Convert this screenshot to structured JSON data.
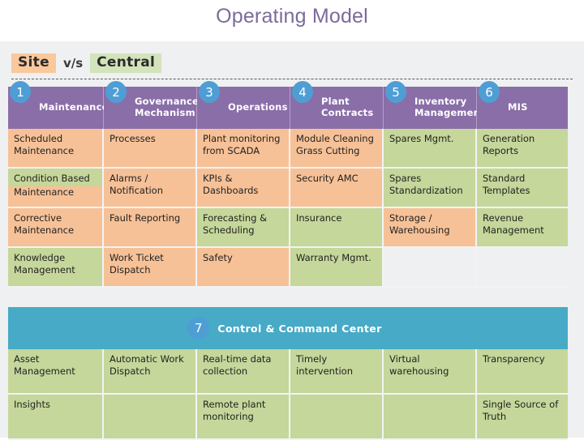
{
  "slide": {
    "title": "Operating Model",
    "title_color": "#7b6b9a",
    "background": "#eff0f1"
  },
  "legend": {
    "site_label": "Site",
    "vs_label": "v/s",
    "central_label": "Central",
    "site_color": "#f9c89b",
    "central_color": "#d3e3bb"
  },
  "colors": {
    "header_purple": "#8a6ea8",
    "badge_blue": "#4e9ed4",
    "ccc_teal": "#47aac6",
    "site_cell": "#f7c197",
    "central_cell": "#c5d79a",
    "empty_cell": "#eff0f1"
  },
  "main_matrix": {
    "columns": [
      {
        "number": "1",
        "label": "Maintenance"
      },
      {
        "number": "2",
        "label": "Governance Mechanism"
      },
      {
        "number": "3",
        "label": "Operations"
      },
      {
        "number": "4",
        "label": "Plant Contracts"
      },
      {
        "number": "5",
        "label": "Inventory Management"
      },
      {
        "number": "6",
        "label": "MIS"
      }
    ],
    "rows": [
      [
        {
          "text": "Scheduled Maintenance",
          "owner": "site"
        },
        {
          "text": "Processes",
          "owner": "site"
        },
        {
          "text": "Plant monitoring from SCADA",
          "owner": "site"
        },
        {
          "text": "Module Cleaning Grass Cutting",
          "owner": "site"
        },
        {
          "text": "Spares Mgmt.",
          "owner": "central"
        },
        {
          "text": "Generation Reports",
          "owner": "central"
        }
      ],
      [
        {
          "text": "Condition Based Maintenance",
          "owner": "mixed",
          "line1": "Condition Based",
          "line2": "Maintenance"
        },
        {
          "text": "Alarms / Notification",
          "owner": "site"
        },
        {
          "text": "KPIs & Dashboards",
          "owner": "site"
        },
        {
          "text": "Security AMC",
          "owner": "site"
        },
        {
          "text": "Spares Standardization",
          "owner": "central"
        },
        {
          "text": "Standard Templates",
          "owner": "central"
        }
      ],
      [
        {
          "text": "Corrective Maintenance",
          "owner": "site"
        },
        {
          "text": "Fault Reporting",
          "owner": "site"
        },
        {
          "text": "Forecasting & Scheduling",
          "owner": "central"
        },
        {
          "text": "Insurance",
          "owner": "central"
        },
        {
          "text": "Storage / Warehousing",
          "owner": "site"
        },
        {
          "text": "Revenue Management",
          "owner": "central"
        }
      ],
      [
        {
          "text": "Knowledge Management",
          "owner": "central"
        },
        {
          "text": "Work Ticket Dispatch",
          "owner": "site"
        },
        {
          "text": "Safety",
          "owner": "site"
        },
        {
          "text": "Warranty Mgmt.",
          "owner": "central"
        },
        {
          "text": "",
          "owner": "empty"
        },
        {
          "text": "",
          "owner": "empty"
        }
      ]
    ]
  },
  "ccc_matrix": {
    "number": "7",
    "title": "Control & Command Center",
    "rows": [
      [
        {
          "text": "Asset Management",
          "owner": "central"
        },
        {
          "text": "Automatic Work Dispatch",
          "owner": "central"
        },
        {
          "text": "Real-time data collection",
          "owner": "central"
        },
        {
          "text": "Timely intervention",
          "owner": "central"
        },
        {
          "text": "Virtual warehousing",
          "owner": "central"
        },
        {
          "text": "Transparency",
          "owner": "central"
        }
      ],
      [
        {
          "text": "Insights",
          "owner": "central"
        },
        {
          "text": "",
          "owner": "central"
        },
        {
          "text": "Remote plant monitoring",
          "owner": "central"
        },
        {
          "text": "",
          "owner": "central"
        },
        {
          "text": "",
          "owner": "central"
        },
        {
          "text": "Single Source of Truth",
          "owner": "central"
        }
      ]
    ]
  }
}
